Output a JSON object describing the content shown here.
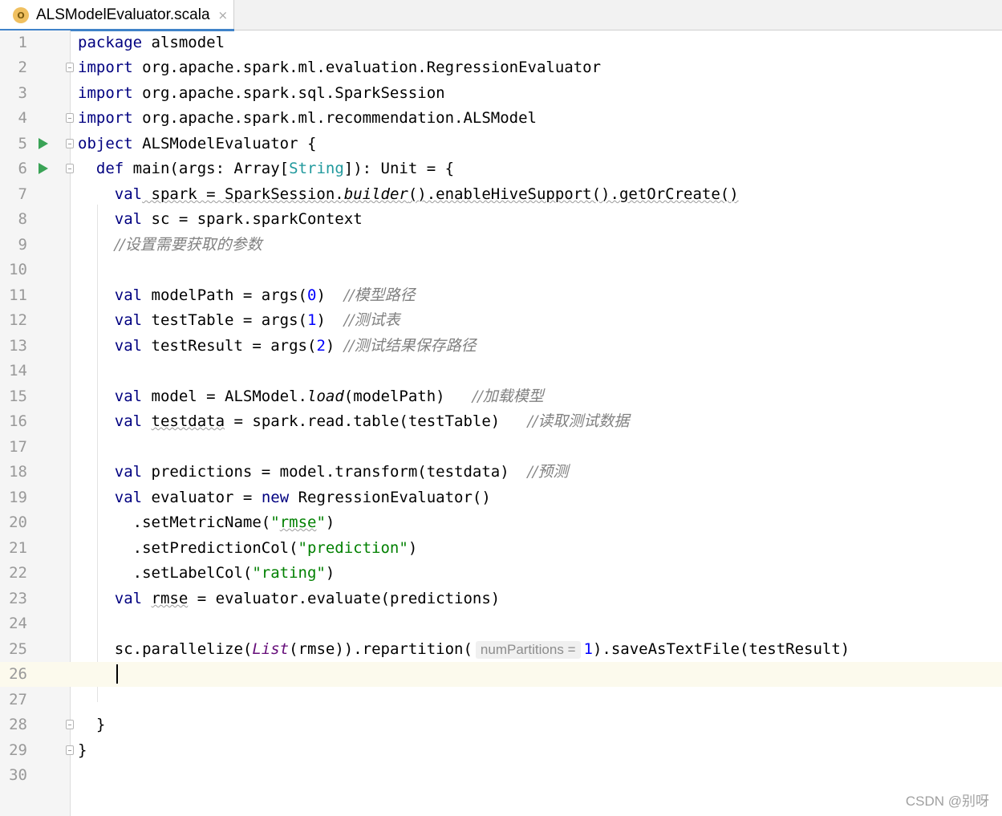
{
  "tab": {
    "icon": "scala-object-icon",
    "icon_glyph": "O",
    "filename": "ALSModelEvaluator.scala",
    "close_glyph": "×"
  },
  "editor": {
    "line_numbers": [
      "1",
      "2",
      "3",
      "4",
      "5",
      "6",
      "7",
      "8",
      "9",
      "10",
      "11",
      "12",
      "13",
      "14",
      "15",
      "16",
      "17",
      "18",
      "19",
      "20",
      "21",
      "22",
      "23",
      "24",
      "25",
      "26",
      "27",
      "28",
      "29",
      "30"
    ],
    "current_line": 26,
    "lines": {
      "l1": {
        "kw": "package",
        "rest": " alsmodel"
      },
      "l2": {
        "kw": "import",
        "rest": " org.apache.spark.ml.evaluation.RegressionEvaluator"
      },
      "l3": {
        "kw": "import",
        "rest": " org.apache.spark.sql.SparkSession"
      },
      "l4": {
        "kw": "import",
        "rest": " org.apache.spark.ml.recommendation.ALSModel"
      },
      "l5": {
        "kw": "object",
        "rest": " ALSModelEvaluator {"
      },
      "l6": {
        "indent": "  ",
        "kw": "def",
        "rest_a": " main(args: Array[",
        "type": "String",
        "rest_b": "]): Unit = {"
      },
      "l7": {
        "indent": "    ",
        "kw": "val",
        "rest_a": " spark = SparkSession.",
        "italic": "builder",
        "rest_b": "().enableHiveSupport().getOrCreate()"
      },
      "l8": {
        "indent": "    ",
        "kw": "val",
        "rest": " sc = spark.sparkContext"
      },
      "l9": {
        "indent": "    ",
        "comment": "//设置需要获取的参数"
      },
      "l11": {
        "indent": "    ",
        "kw": "val",
        "rest_a": " modelPath = args(",
        "num": "0",
        "rest_b": ")  ",
        "comment": "//模型路径"
      },
      "l12": {
        "indent": "    ",
        "kw": "val",
        "rest_a": " testTable = args(",
        "num": "1",
        "rest_b": ")  ",
        "comment": "//测试表"
      },
      "l13": {
        "indent": "    ",
        "kw": "val",
        "rest_a": " testResult = args(",
        "num": "2",
        "rest_b": ") ",
        "comment": "//测试结果保存路径"
      },
      "l15": {
        "indent": "    ",
        "kw": "val",
        "rest_a": " model = ALSModel.",
        "italic": "load",
        "rest_b": "(modelPath)   ",
        "comment": "//加载模型"
      },
      "l16": {
        "indent": "    ",
        "kw": "val",
        "sp": " ",
        "var": "testdata",
        "rest": " = spark.read.table(testTable)   ",
        "comment": "//读取测试数据"
      },
      "l18": {
        "indent": "    ",
        "kw": "val",
        "rest": " predictions = model.transform(testdata)  ",
        "comment": "//预测"
      },
      "l19": {
        "indent": "    ",
        "kw": "val",
        "rest_a": " evaluator = ",
        "kw2": "new",
        "rest_b": " RegressionEvaluator()"
      },
      "l20": {
        "indent": "      ",
        "rest_a": ".setMetricName(",
        "str_a": "\"",
        "str_var": "rmse",
        "str_b": "\"",
        "rest_b": ")"
      },
      "l21": {
        "indent": "      ",
        "rest_a": ".setPredictionCol(",
        "str": "\"prediction\"",
        "rest_b": ")"
      },
      "l22": {
        "indent": "      ",
        "rest_a": ".setLabelCol(",
        "str": "\"rating\"",
        "rest_b": ")"
      },
      "l23": {
        "indent": "    ",
        "kw": "val",
        "sp": " ",
        "var": "rmse",
        "rest": " = evaluator.evaluate(predictions)"
      },
      "l25": {
        "indent": "    ",
        "rest_a": "sc.parallelize(",
        "fn": "List",
        "rest_b": "(rmse)).repartition(",
        "hint": "numPartitions =",
        "num": "1",
        "rest_c": ").saveAsTextFile(testResult)"
      },
      "l28": {
        "indent": "  ",
        "rest": "}"
      },
      "l29": {
        "rest": "}"
      }
    }
  },
  "watermark": "CSDN @别呀"
}
